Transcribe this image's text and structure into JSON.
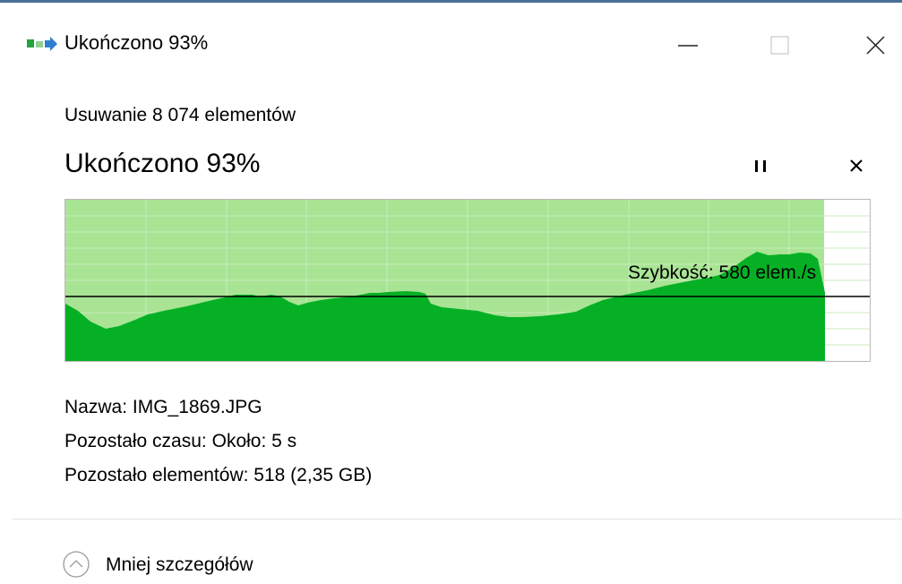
{
  "window": {
    "title": "Ukończono 93%",
    "icon": "file-operation-icon",
    "controls": [
      "minimize-icon",
      "maximize-icon",
      "close-icon"
    ]
  },
  "operation": {
    "description": "Usuwanie 8 074 elementów",
    "status": "Ukończono 93%",
    "progress": 0.93
  },
  "graph": {
    "speed_label": "Szybkość: 580 elem./s",
    "colors": {
      "background": "#ffffff",
      "progress_fill": "#a8e494",
      "speed_fill": "#06b025",
      "grid": "#c8ecbc",
      "speed_line": "#000000"
    }
  },
  "details": {
    "name_label": "Nazwa:",
    "name_value": "IMG_1869.JPG",
    "time_label": "Pozostało czasu:",
    "time_value": "Około: 5 s",
    "items_label": "Pozostało elementów:",
    "items_value": "518 (2,35 GB)"
  },
  "footer": {
    "less_details": "Mniej szczegółów",
    "icon": "chevron-up-circle-icon"
  }
}
